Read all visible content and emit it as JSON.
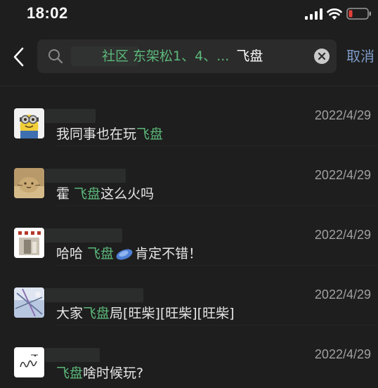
{
  "status_bar": {
    "time": "18:02"
  },
  "search": {
    "group_text": "社区 东架松1、4、...",
    "query": "飞盘",
    "cancel_label": "取消"
  },
  "results": [
    {
      "date": "2022/4/29",
      "message_before": "我同事也在玩",
      "keyword": "飞盘",
      "message_after": ""
    },
    {
      "date": "2022/4/29",
      "message_before": "霍 ",
      "keyword": "飞盘",
      "message_after": "这么火吗"
    },
    {
      "date": "2022/4/29",
      "message_before": "哈哈 ",
      "keyword": "飞盘",
      "message_after": "肯定不错！"
    },
    {
      "date": "2022/4/29",
      "message_before": "大家",
      "keyword": "飞盘",
      "message_after": "局[旺柴][旺柴][旺柴]"
    },
    {
      "date": "2022/4/29",
      "message_before": "",
      "keyword": "飞盘",
      "message_after": "啥时候玩?"
    }
  ],
  "icons": {
    "back": "chevron-left-icon",
    "search": "search-icon",
    "clear": "clear-icon",
    "signal": "signal-icon",
    "wifi": "wifi-icon",
    "battery": "battery-icon",
    "frisbee": "frisbee-icon"
  },
  "colors": {
    "background": "#1e1e1e",
    "highlight_green": "#5cb87a",
    "cancel_blue": "#7d9bc8",
    "date_gray": "#a0a0a0",
    "battery_low": "#e5413b"
  }
}
